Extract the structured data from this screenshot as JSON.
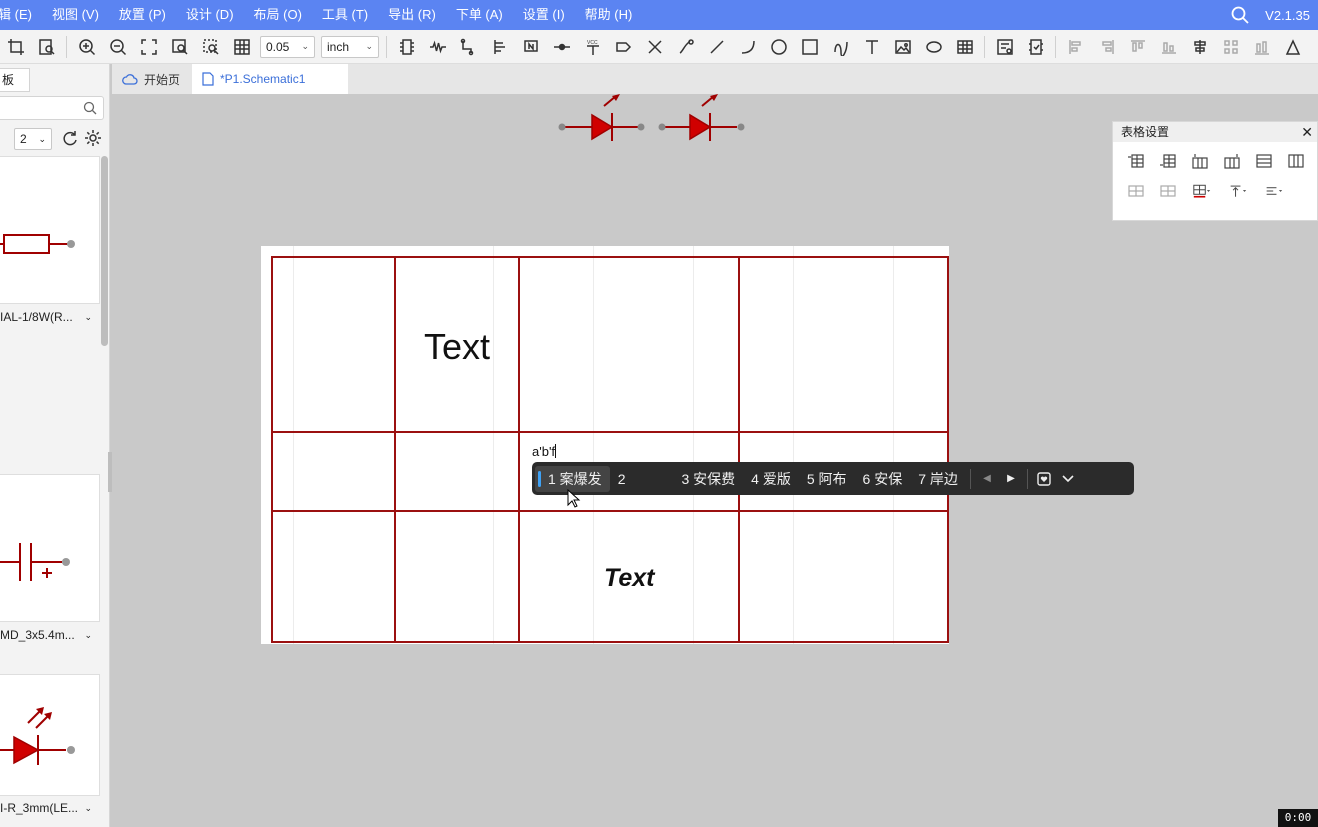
{
  "menubar": {
    "items": [
      "辑 (E)",
      "视图 (V)",
      "放置 (P)",
      "设计 (D)",
      "布局 (O)",
      "工具 (T)",
      "导出 (R)",
      "下单 (A)",
      "设置 (I)",
      "帮助 (H)"
    ],
    "version": "V2.1.35"
  },
  "toolbar": {
    "grid_value": "0.05",
    "unit_value": "inch"
  },
  "left_panel": {
    "tab_label": "板",
    "page_value": "2",
    "components": [
      {
        "name": "IAL-1/8W(R..."
      },
      {
        "name": "MD_3x5.4m..."
      },
      {
        "name": "I-R_3mm(LE..."
      }
    ]
  },
  "tabs": {
    "home": "开始页",
    "active": "*P1.Schematic1"
  },
  "table": {
    "cell_r1c2": "Text",
    "cell_r2c3_input": "a'b'f",
    "cell_r3c3": "Text"
  },
  "ime": {
    "candidates": [
      "1 案爆发",
      "2",
      "3 安保费",
      "4 爱版",
      "5 阿布",
      "6 安保",
      "7 岸边"
    ]
  },
  "table_settings": {
    "title": "表格设置"
  },
  "timer": "0:00",
  "colors": {
    "menubar": "#5b84f2",
    "schematic_red": "#a00000",
    "table_line": "#9b1010"
  }
}
